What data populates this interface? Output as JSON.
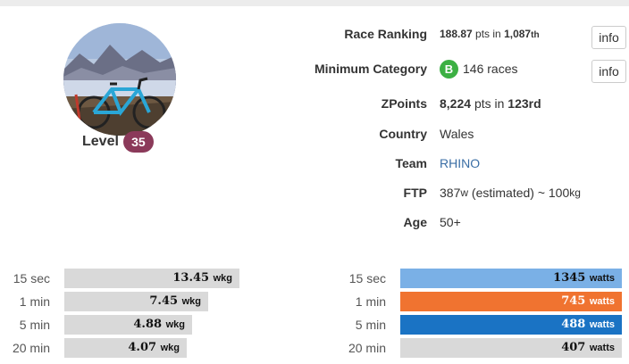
{
  "profile": {
    "level_label": "Level",
    "level_value": "35"
  },
  "info": {
    "race_ranking": {
      "label": "Race Ranking",
      "points": "188.87",
      "pts_in": "pts in",
      "rank": "1,087",
      "suffix": "th",
      "button": "info"
    },
    "minimum_category": {
      "label": "Minimum Category",
      "badge": "B",
      "races": "146 races",
      "button": "info",
      "badge_color": "#3cb043"
    },
    "zpoints": {
      "label": "ZPoints",
      "points": "8,224",
      "pts_in": "pts in",
      "rank": "123rd"
    },
    "country": {
      "label": "Country",
      "value": "Wales"
    },
    "team": {
      "label": "Team",
      "value": "RHINO"
    },
    "ftp": {
      "label": "FTP",
      "watts": "387",
      "w_unit": "w",
      "estimated": " (estimated) ~ 100",
      "kg_unit": "kg"
    },
    "age": {
      "label": "Age",
      "value": "50+"
    }
  },
  "wkg_bars": [
    {
      "label": "15 sec",
      "value": "13.45",
      "unit": "wkg",
      "fraction": 1.0
    },
    {
      "label": "1 min",
      "value": "7.45",
      "unit": "wkg",
      "fraction": 0.82
    },
    {
      "label": "5 min",
      "value": "4.88",
      "unit": "wkg",
      "fraction": 0.73
    },
    {
      "label": "20 min",
      "value": "4.07",
      "unit": "wkg",
      "fraction": 0.7
    }
  ],
  "watts_bars": [
    {
      "label": "15 sec",
      "value": "1345",
      "unit": "watts",
      "fraction": 1.0,
      "color": "#7ab0e6",
      "track": "#d9d9d9"
    },
    {
      "label": "1 min",
      "value": "745",
      "unit": "watts",
      "fraction": 1.0,
      "color": "#f07330",
      "track": "#d9d9d9"
    },
    {
      "label": "5 min",
      "value": "488",
      "unit": "watts",
      "fraction": 1.0,
      "color": "#1a73c4",
      "track": "#d9d9d9"
    },
    {
      "label": "20 min",
      "value": "407",
      "unit": "watts",
      "fraction": 1.0,
      "color": "#d9d9d9",
      "track": "#d9d9d9"
    }
  ]
}
